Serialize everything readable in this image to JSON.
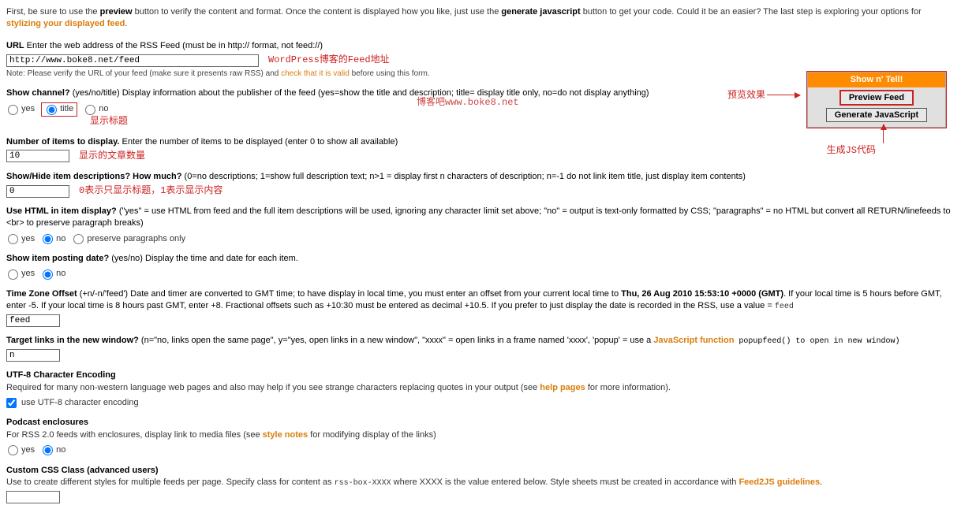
{
  "intro": {
    "pre_preview": "First, be sure to use the ",
    "preview_word": "preview",
    "mid1": " button to verify the content and format. Once the content is displayed how you like, just use the ",
    "gen_word": "generate javascript",
    "mid2": " button to get your code. Could it be an easier? The last step is exploring your options for ",
    "stylize_link": "stylizing your displayed feed",
    "period": "."
  },
  "url": {
    "label": "URL",
    "desc": " Enter the web address of the RSS Feed (must be in http:// format, not feed://)",
    "value": "http://www.boke8.net/feed",
    "annot": "WordPress博客的Feed地址",
    "note_pre": "Note: Please verify the URL of your feed (make sure it presents raw RSS) and ",
    "note_link": "check that it is valid",
    "note_post": " before using this form."
  },
  "channel": {
    "label": "Show channel?",
    "desc": " (yes/no/title) Display information about the publisher of the feed (yes=show the title and description; title= display title only, no=do not display anything)",
    "opt_yes": "yes",
    "opt_title": "title",
    "opt_no": "no",
    "annot": "显示标题"
  },
  "num_items": {
    "label": "Number of items to display.",
    "desc": " Enter the number of items to be displayed (enter 0 to show all available)",
    "value": "10",
    "annot": "显示的文章数量"
  },
  "show_desc": {
    "label": "Show/Hide item descriptions? How much?",
    "desc": " (0=no descriptions; 1=show full description text; n>1 = display first n characters of description; n=-1 do not link item title, just display item contents)",
    "value": "0",
    "annot": "0表示只显示标题，1表示显示内容"
  },
  "use_html": {
    "label": "Use HTML in item display?",
    "desc": " (\"yes\" = use HTML from feed and the full item descriptions will be used, ignoring any character limit set above; \"no\" = output is text-only formatted by CSS; \"paragraphs\" = no HTML but convert all RETURN/linefeeds to <br> to preserve paragraph breaks)",
    "opt_yes": "yes",
    "opt_no": "no",
    "opt_para": "preserve paragraphs only"
  },
  "posting_date": {
    "label": "Show item posting date?",
    "desc": " (yes/no) Display the time and date for each item.",
    "opt_yes": "yes",
    "opt_no": "no"
  },
  "tz": {
    "label": "Time Zone Offset",
    "desc1": " (+n/-n/'feed') Date and timer are converted to GMT time; to have display in local time, you must enter an offset from your current local time to ",
    "date": "Thu, 26 Aug 2010 15:53:10 +0000 (GMT)",
    "desc2": ". If your local time is 5 hours before GMT, enter -5. If your local time is 8 hours past GMT, enter +8. Fractional offsets such as +10:30 must be entered as decimal +10.5. If you prefer to just display the date is recorded in the RSS, use a value = ",
    "feed_code": "feed",
    "value": "feed"
  },
  "target": {
    "label": "Target links in the new window?",
    "desc1": " (n=\"no, links open the same page\", y=\"yes, open links in a new window\", \"xxxx\" = open links in a frame named 'xxxx', 'popup' = use a ",
    "js_link": "JavaScript function",
    "desc2": " popupfeed() to open in new window)",
    "value": "n"
  },
  "utf8": {
    "label": "UTF-8 Character Encoding",
    "desc_pre": "Required for many non-western language web pages and also may help if you see strange characters replacing quotes in your output (see ",
    "help_link": "help pages",
    "desc_post": " for more information).",
    "cb_label": "use UTF-8 character encoding"
  },
  "podcast": {
    "label": "Podcast enclosures",
    "desc_pre": "For RSS 2.0 feeds with enclosures, display link to media files (see ",
    "style_link": "style notes",
    "desc_post": " for modifying display of the links)",
    "opt_yes": "yes",
    "opt_no": "no"
  },
  "css": {
    "label": "Custom CSS Class (advanced users)",
    "desc_pre": "Use to create different styles for multiple feeds per page. Specify class for content as ",
    "code": "rss-box-XXXX",
    "desc_mid": " where XXXX is the value entered below. Style sheets must be created in accordance with ",
    "guide_link": "Feed2JS guidelines",
    "period": ".",
    "value": ""
  },
  "panel": {
    "header": "Show n' Tell!",
    "preview": "Preview Feed",
    "generate": "Generate JavaScript",
    "annot_preview": "预览效果",
    "annot_generate": "生成JS代码"
  },
  "watermark": "博客吧www.boke8.net"
}
